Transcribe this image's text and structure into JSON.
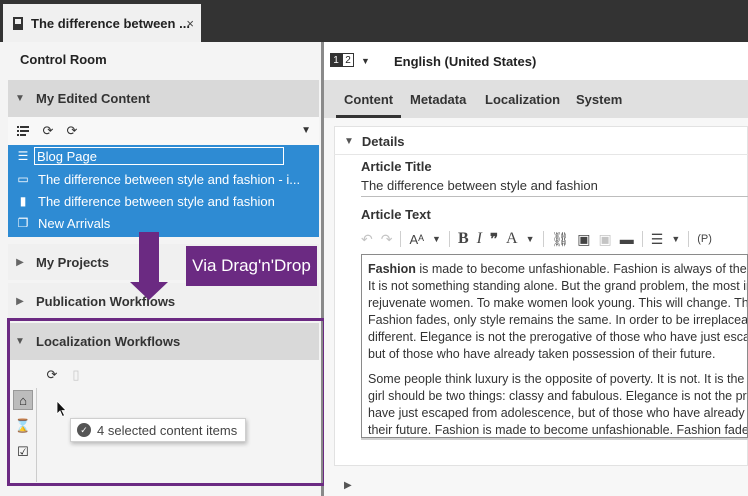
{
  "window_tab": {
    "title": "The difference between ...",
    "icon": "article-icon",
    "close": "×"
  },
  "left_panel": {
    "title": "Control Room",
    "my_edited_content": {
      "label": "My Edited Content",
      "toolbar_icons": [
        "list-add-icon",
        "sync-icon",
        "sync-alt-icon"
      ],
      "items": [
        {
          "label": "Blog Page",
          "icon": "page-icon",
          "editing": true
        },
        {
          "label": "The difference between style and fashion - i...",
          "icon": "teaser-icon"
        },
        {
          "label": "The difference between style and fashion",
          "icon": "article-icon"
        },
        {
          "label": "New Arrivals",
          "icon": "collection-icon"
        }
      ]
    },
    "my_projects": {
      "label": "My Projects"
    },
    "publication_workflows": {
      "label": "Publication Workflows"
    },
    "localization_workflows": {
      "label": "Localization Workflows",
      "side_buttons": [
        "inbox-icon",
        "hourglass-icon",
        "checkbox-icon"
      ]
    }
  },
  "overlay": {
    "drag_label": "Via Drag'n'Drop",
    "tooltip": "4 selected content items",
    "accent": "#6b2a82"
  },
  "right_panel": {
    "locale_switch": {
      "left": "1",
      "right": "2"
    },
    "locale": "English (United States)",
    "tabs": [
      "Content",
      "Metadata",
      "Localization",
      "System"
    ],
    "active_tab": "Content",
    "details": {
      "label": "Details",
      "article_title_label": "Article Title",
      "article_title_value": "The difference between style and fashion",
      "article_text_label": "Article Text",
      "toolbar": {
        "font_size": "A",
        "bold": "B",
        "italic": "I",
        "quote": "❞",
        "font_color": "A",
        "paragraph": "(P)"
      },
      "paragraph1": [
        {
          "bold": "Fashion",
          "rest": " is made to become unfashionable. Fashion is always of the t"
        },
        {
          "rest": "It is not something standing alone. But the grand problem, the most ir"
        },
        {
          "rest": "rejuvenate women. To make women look young. This will change. The"
        },
        {
          "rest": "Fashion fades, only style remains the same. In order to be irreplaceab"
        },
        {
          "rest": "different. Elegance is not the prerogative of those who have just escap"
        },
        {
          "rest": "but of those who have already taken possession of their future."
        }
      ],
      "paragraph2": [
        "Some people think luxury is the opposite of poverty. It is not. It is the c",
        "girl should be two things: classy and fabulous. Elegance is not the pre",
        "have just escaped from adolescence, but of those who have already t",
        "their future. Fashion is made to become unfashionable. Fashion fades"
      ]
    }
  }
}
